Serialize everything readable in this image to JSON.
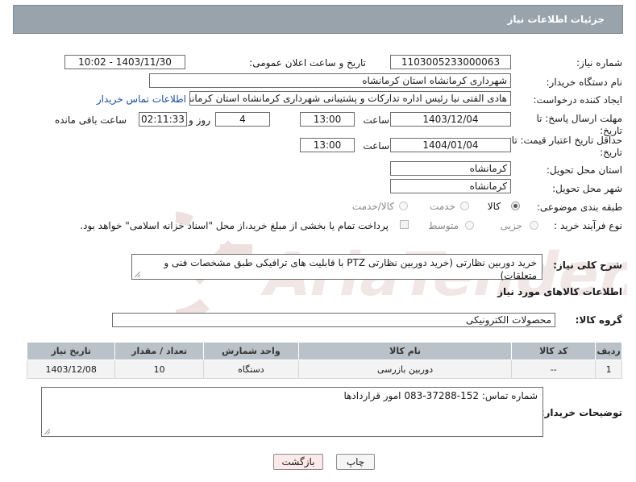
{
  "header": {
    "title": "جزئیات اطلاعات نیاز"
  },
  "need_number": {
    "label": "شماره نیاز:",
    "value": "1103005233000063"
  },
  "announce_datetime": {
    "label": "تاریخ و ساعت اعلان عمومی:",
    "value": "1403/11/30 - 10:02"
  },
  "buyer_org": {
    "label": "نام دستگاه خریدار:",
    "value": "شهرداری کرمانشاه استان کرمانشاه"
  },
  "requester": {
    "label": "ایجاد کننده درخواست:",
    "value": "هادی الفتی نیا رئیس اداره تدارکات و پشتیبانی شهرداری کرمانشاه استان کرمانشاه",
    "contact_link": "اطلاعات تماس خریدار"
  },
  "reply_deadline": {
    "label_line1": "مهلت ارسال پاسخ: تا",
    "label_line2": "تاریخ:",
    "date": "1403/12/04",
    "time_label": "ساعت",
    "time": "13:00",
    "days": "4",
    "days_label": "روز و",
    "remaining": "02:11:33",
    "remaining_label": "ساعت باقی مانده"
  },
  "price_validity": {
    "label_line1": "حداقل تاریخ اعتبار قیمت: تا",
    "label_line2": "تاریخ:",
    "date": "1404/01/04",
    "time_label": "ساعت",
    "time": "13:00"
  },
  "delivery_province": {
    "label": "استان محل تحویل:",
    "value": "کرمانشاه"
  },
  "delivery_city": {
    "label": "شهر محل تحویل:",
    "value": "کرمانشاه"
  },
  "category": {
    "label": "طبقه بندی موضوعی:",
    "options": [
      "کالا",
      "خدمت",
      "کالا/خدمت"
    ],
    "selected": "کالا"
  },
  "purchase_process": {
    "label": "نوع فرآیند خرید :",
    "options": [
      "جزیی",
      "متوسط"
    ],
    "note": "پرداخت تمام یا بخشی از مبلغ خرید،از محل \"اسناد خزانه اسلامی\" خواهد بود."
  },
  "general_description": {
    "label": "شرح کلی نیاز:",
    "value": "خرید دوربین نظارتی (خرید دوربین نظارتی PTZ با قابلیت های ترافیکی طبق مشخصات فنی و متعلقات)"
  },
  "goods_section": {
    "title": "اطلاعات کالاهای مورد نیاز"
  },
  "goods_group": {
    "label": "گروه کالا:",
    "value": "محصولات الکترونیکی"
  },
  "goods_table": {
    "headers": [
      "ردیف",
      "کد کالا",
      "نام کالا",
      "واحد شمارش",
      "تعداد / مقدار",
      "تاریخ نیاز"
    ],
    "rows": [
      [
        "1",
        "--",
        "دوربین بازرسی",
        "دستگاه",
        "10",
        "1403/12/08"
      ]
    ]
  },
  "buyer_notes": {
    "label": "توضیحات خریدار:",
    "value": "شماره تماس: 152-37288-083 امور قراردادها"
  },
  "buttons": {
    "print": "چاپ",
    "back": "بازگشت"
  },
  "watermark": {
    "text": "AriaTender.net"
  },
  "colors": {
    "header_bg": "#98a3ab",
    "table_header_bg": "#b9c2c8",
    "link": "#1a4d9e",
    "back_button_bg": "#fde9e9"
  }
}
